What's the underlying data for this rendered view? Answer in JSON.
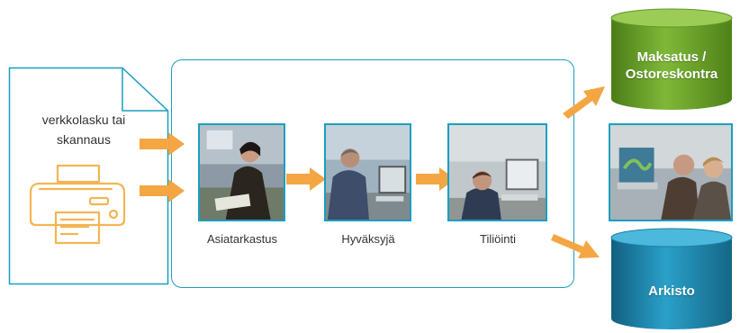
{
  "source": {
    "label_line1": "verkkolasku tai",
    "label_line2": "skannaus"
  },
  "steps": [
    {
      "label": "Asiatarkastus"
    },
    {
      "label": "Hyväksyjä"
    },
    {
      "label": "Tiliöinti"
    }
  ],
  "outputs": {
    "payment": {
      "label_line1": "Maksatus /",
      "label_line2": "Ostoreskontra"
    },
    "archive": {
      "label": "Arkisto"
    }
  },
  "colors": {
    "outline": "#1a9fc0",
    "arrow": "#f4a642",
    "printer": "#f4b553",
    "payment_db": "#6da62b",
    "archive_db": "#1d86ad"
  }
}
